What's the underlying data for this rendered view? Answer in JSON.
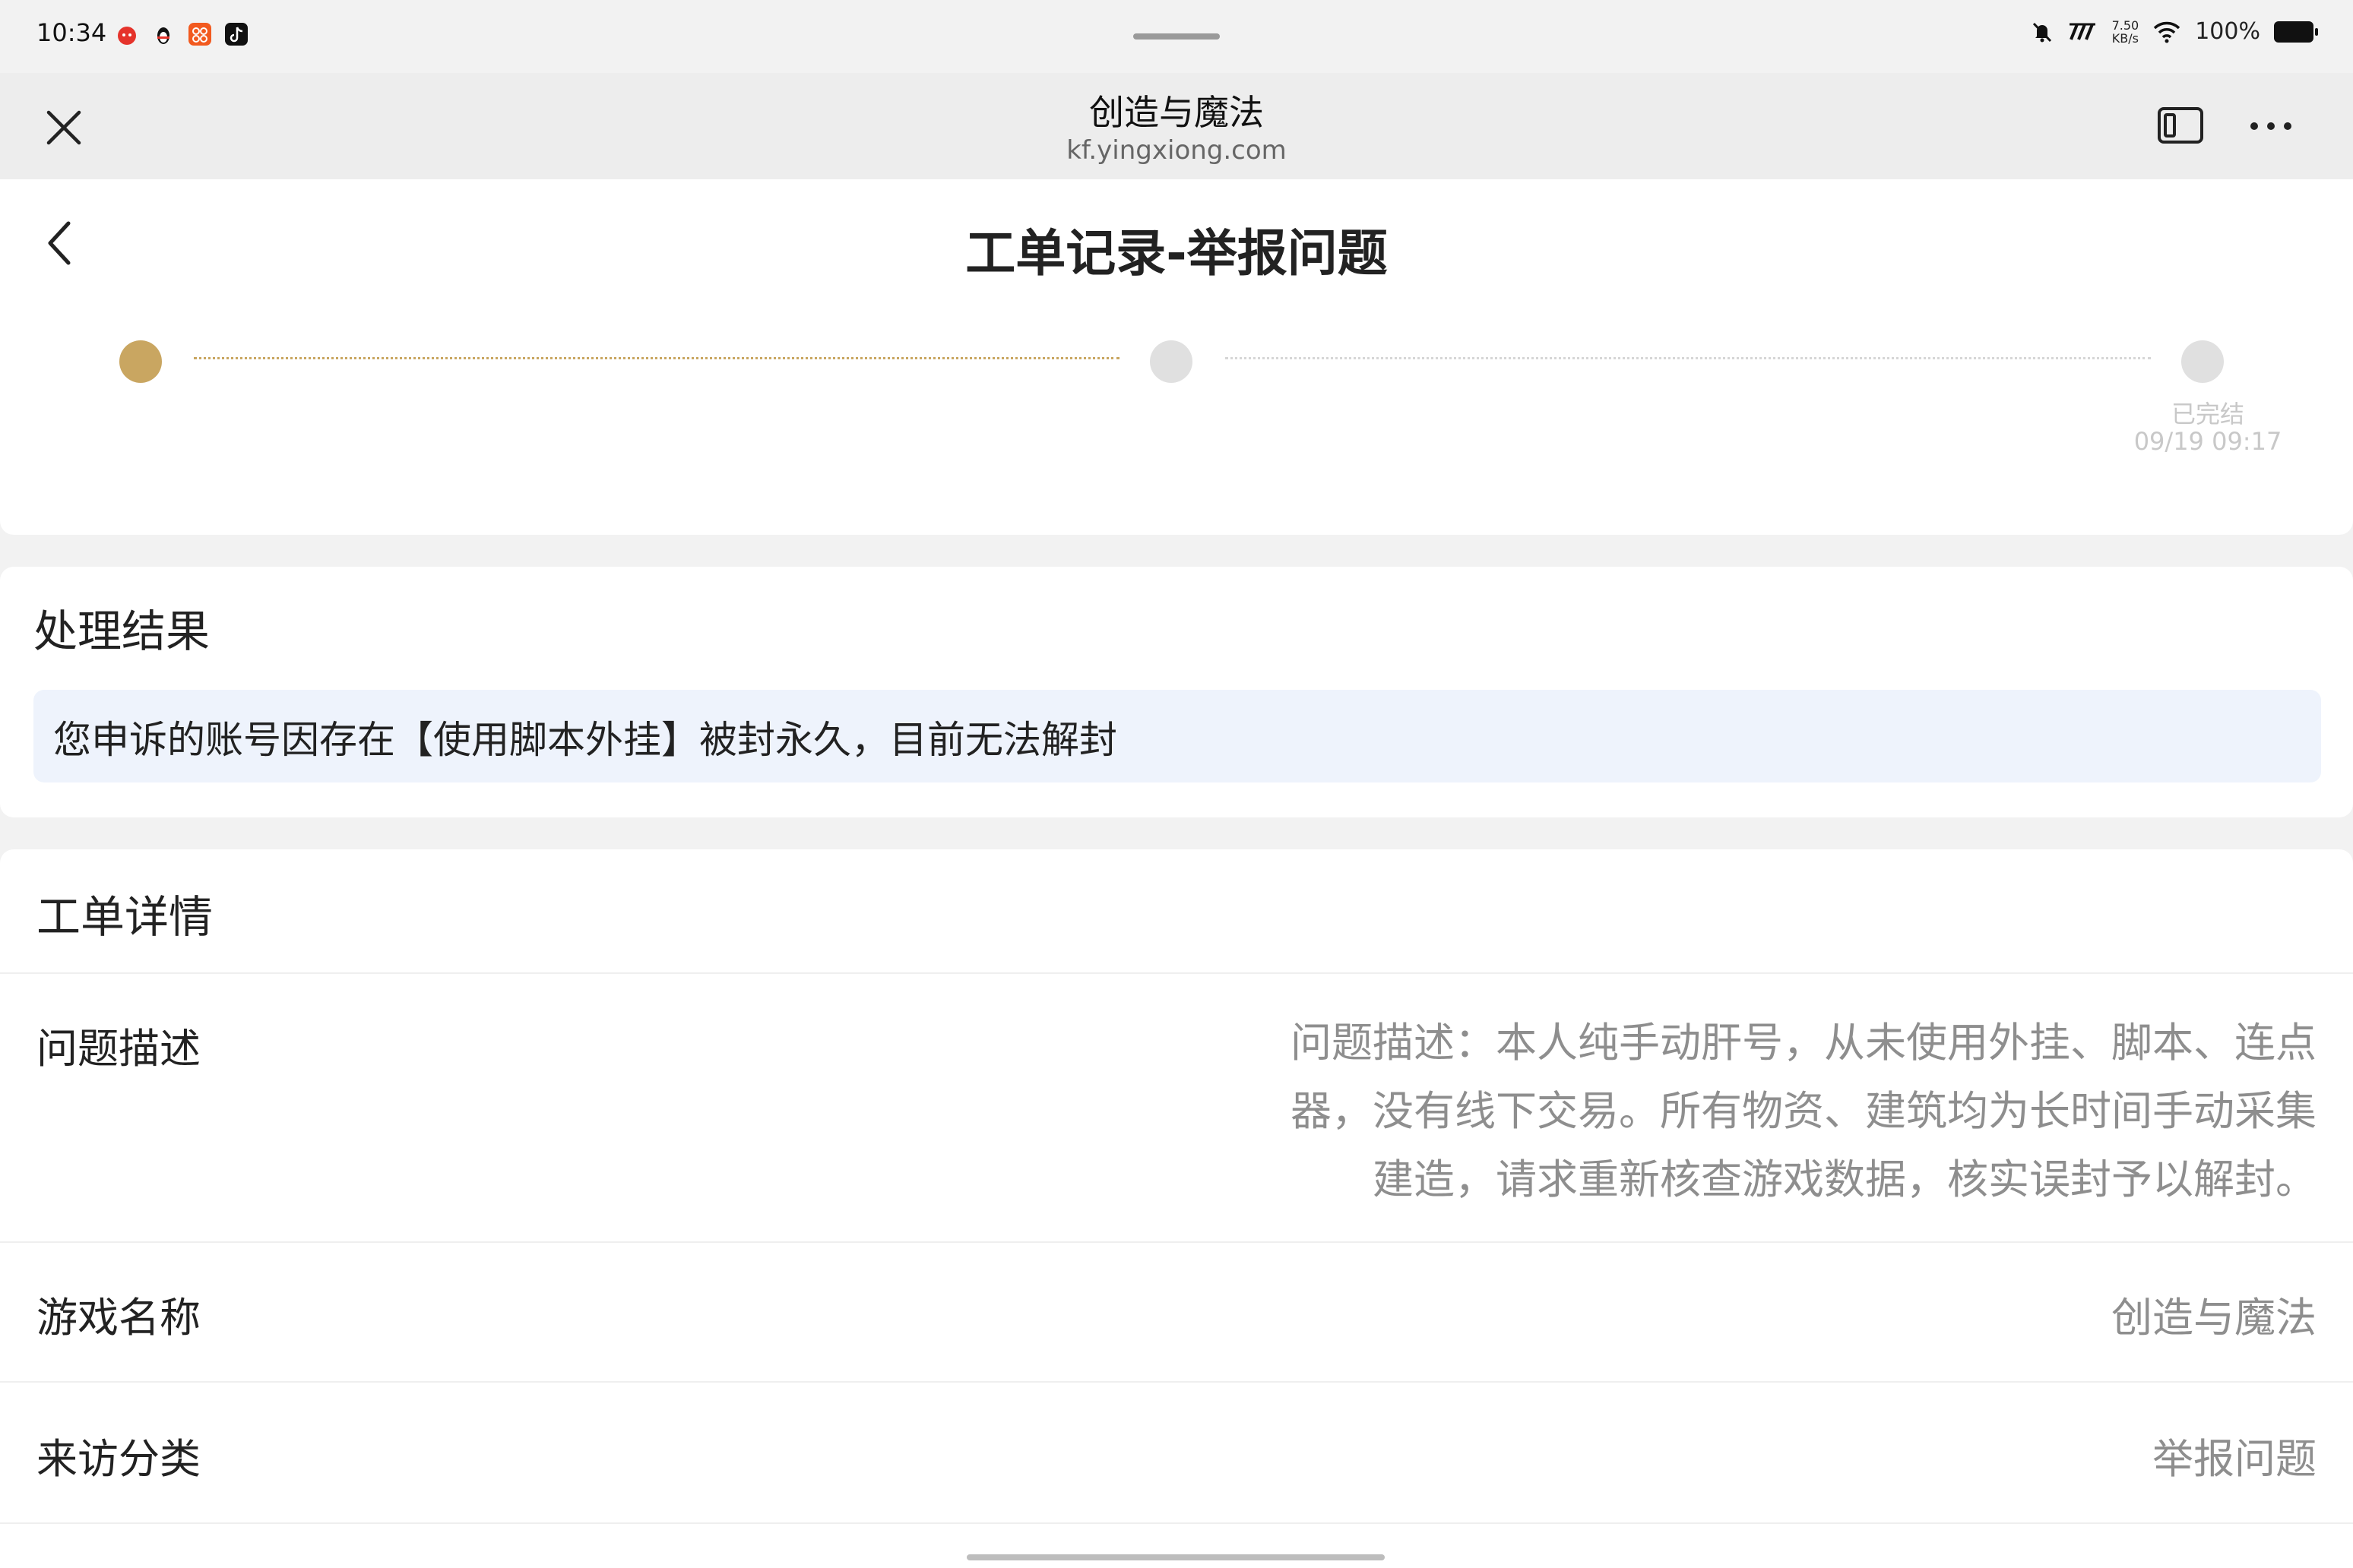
{
  "status_bar": {
    "time": "10:34",
    "notification_icons": [
      "app-icon-red",
      "app-icon-penguin",
      "app-icon-orange",
      "app-icon-tiktok"
    ],
    "speed_value": "7.50",
    "speed_unit": "KB/s",
    "battery": "100%"
  },
  "browser": {
    "title": "创造与魔法",
    "url": "kf.yingxiong.com"
  },
  "page": {
    "title": "工单记录-举报问题"
  },
  "progress": {
    "active_color": "#c9a661",
    "inactive_color": "#e0e0e0",
    "final_step_status": "已完结",
    "final_step_time": "09/19 09:17"
  },
  "result": {
    "heading": "处理结果",
    "text": "您申诉的账号因存在【使用脚本外挂】被封永久，目前无法解封"
  },
  "details": {
    "heading": "工单详情",
    "rows": [
      {
        "label": "问题描述",
        "value_lines": [
          "问题描述：本人纯手动肝号，从未使用外挂、脚本、连点",
          "器，没有线下交易。所有物资、建筑均为长时间手动采集",
          "建造，请求重新核查游戏数据，核实误封予以解封。"
        ]
      },
      {
        "label": "游戏名称",
        "value": "创造与魔法"
      },
      {
        "label": "来访分类",
        "value": "举报问题"
      }
    ]
  }
}
